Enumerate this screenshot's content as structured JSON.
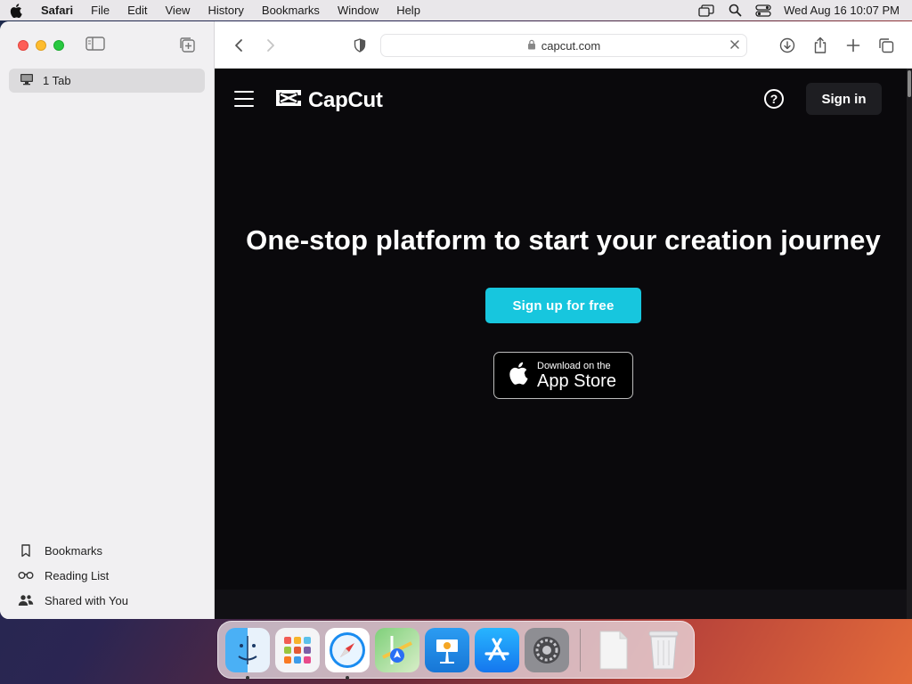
{
  "menubar": {
    "app_name": "Safari",
    "menus": [
      "File",
      "Edit",
      "View",
      "History",
      "Bookmarks",
      "Window",
      "Help"
    ],
    "clock": "Wed Aug 16  10:07 PM"
  },
  "sidebar": {
    "tab_label": "1 Tab",
    "links": [
      {
        "label": "Bookmarks",
        "icon": "bookmark-icon"
      },
      {
        "label": "Reading List",
        "icon": "glasses-icon"
      },
      {
        "label": "Shared with You",
        "icon": "people-icon"
      }
    ]
  },
  "toolbar": {
    "url": "capcut.com"
  },
  "page": {
    "logo_text": "CapCut",
    "help_glyph": "?",
    "signin_label": "Sign in",
    "headline": "One-stop platform to start your creation journey",
    "signup_label": "Sign up for free",
    "appstore_small": "Download on the",
    "appstore_big": "App Store"
  },
  "colors": {
    "accent": "#17c6de",
    "page_bg": "#0a090c"
  },
  "dock": {
    "apps": [
      "finder",
      "launchpad",
      "safari",
      "maps",
      "keynote",
      "app-store",
      "system-settings",
      "document",
      "trash"
    ]
  }
}
